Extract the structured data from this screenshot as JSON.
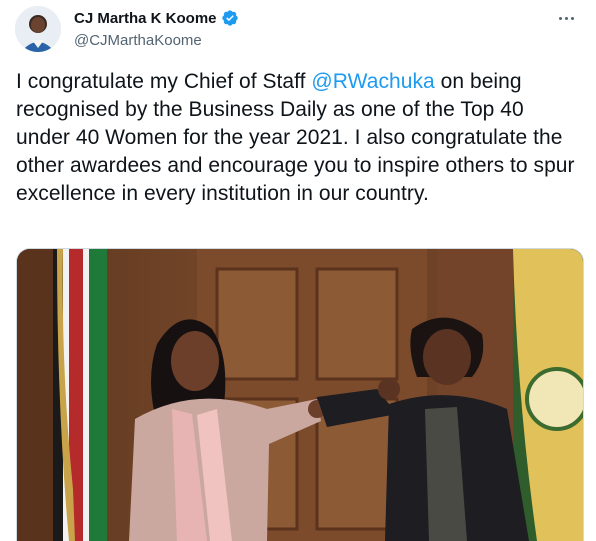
{
  "author": {
    "display_name": "CJ Martha K Koome",
    "handle": "@CJMarthaKoome",
    "verified": true,
    "avatar_icon": "profile-photo"
  },
  "more_icon": "more-horizontal-icon",
  "tweet": {
    "text_before": "I congratulate my Chief of Staff ",
    "mention": "@RWachuka",
    "text_after": " on being recognised by the Business Daily as one of the Top 40 under 40 Women for the year 2021. I also congratulate the other awardees and encourage you to inspire others to spur excellence in every institution in our country."
  },
  "media": {
    "description_icon": "photo-two-women-elbow-bump",
    "flag_icon": "kenya-flag-icon",
    "right_flag_icon": "judiciary-flag-icon"
  },
  "colors": {
    "link": "#1d9bf0",
    "text": "#0f1419",
    "secondary": "#536471",
    "verified": "#1d9bf0"
  }
}
